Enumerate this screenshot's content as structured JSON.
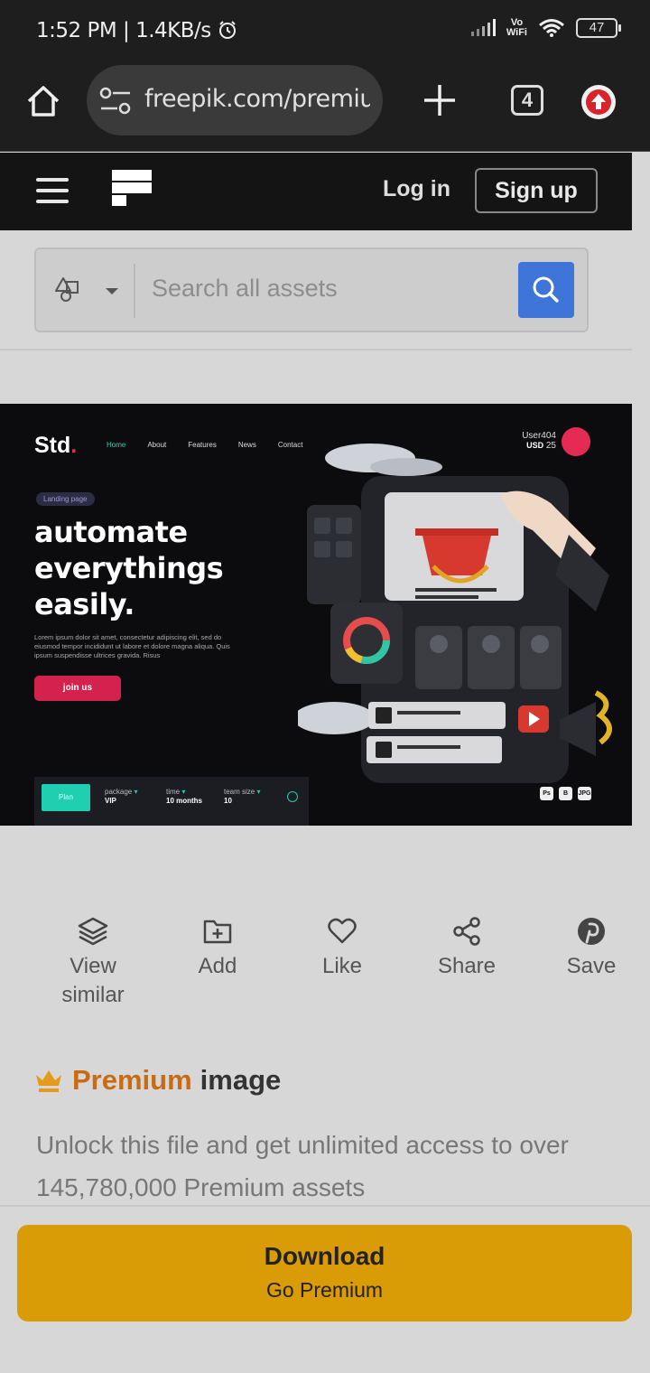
{
  "status_bar": {
    "time": "1:52 PM",
    "speed": "1.4KB/s",
    "network_label_top": "Vo",
    "network_label_bottom": "WiFi",
    "battery": "47"
  },
  "browser": {
    "url": "freepik.com/premium",
    "tab_count": "4"
  },
  "site_header": {
    "login_label": "Log in",
    "signup_label": "Sign up"
  },
  "search": {
    "placeholder": "Search all assets"
  },
  "preview": {
    "logo_text": "Std",
    "logo_dot": ".",
    "nav": [
      "Home",
      "About",
      "Features",
      "News",
      "Contact"
    ],
    "user_name": "User404",
    "user_balance_currency": "USD",
    "user_balance_value": "25",
    "badge": "Landing page",
    "headline_lines": [
      "automate",
      "everythings",
      "easily."
    ],
    "body_text": "Lorem ipsum dolor sit amet, consectetur adipiscing elit, sed do eiusmod tempor incididunt ut labore et dolore magna aliqua. Quis ipsum suspendisse ultrices gravida. Risus",
    "cta": "join us",
    "plan_label": "Plan",
    "meta": [
      {
        "label": "package",
        "value": "VIP"
      },
      {
        "label": "time",
        "value": "10 months"
      },
      {
        "label": "team size",
        "value": "10"
      }
    ],
    "formats": [
      "Ps",
      "B",
      "JPG"
    ]
  },
  "actions": [
    {
      "label_line1": "View",
      "label_line2": "similar",
      "icon": "layers-icon"
    },
    {
      "label_line1": "Add",
      "label_line2": "",
      "icon": "folder-add-icon"
    },
    {
      "label_line1": "Like",
      "label_line2": "",
      "icon": "heart-icon"
    },
    {
      "label_line1": "Share",
      "label_line2": "",
      "icon": "share-icon"
    },
    {
      "label_line1": "Save",
      "label_line2": "",
      "icon": "pinterest-icon"
    }
  ],
  "premium": {
    "word_premium": "Premium",
    "word_image": "image",
    "description": "Unlock this file and get unlimited access to over 145,780,000 Premium assets"
  },
  "download": {
    "main_label": "Download",
    "sub_label": "Go Premium"
  },
  "colors": {
    "accent_blue": "#3f74d8",
    "premium_orange": "#c96b12",
    "download_gold": "#d99b06",
    "preview_pink": "#d3224e",
    "preview_teal": "#1fcfb0"
  }
}
